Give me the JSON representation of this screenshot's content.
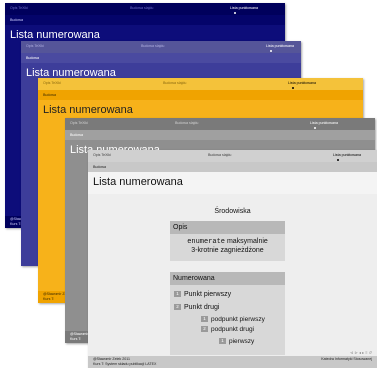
{
  "nav": {
    "left": "Opis TeXiki",
    "middle": "Budowa slajdu",
    "right": "Lista punktowana",
    "right_active": "Lista punktowana"
  },
  "subsection": "Budowa",
  "title": "Lista numerowana",
  "footer": {
    "author": "@Sławomir Zelek 2011",
    "short_author": "@Sławomir Zelek",
    "course": "Kurs T: System składu publikacji LATEX",
    "course_short": "Kurs T:",
    "dept": "Katedra Informatyki Stosowanej"
  },
  "content": {
    "env_label": "Środowiska",
    "opis_header": "Opis",
    "opis_line1_code": "enumerate",
    "opis_line1_rest": " maksymalnie",
    "opis_line2": "3-krotnie zagnieżdżone",
    "num_header": "Numerowana",
    "items": [
      {
        "n": "1",
        "text": "Punkt pierwszy"
      },
      {
        "n": "2",
        "text": "Punkt drugi"
      }
    ],
    "subitems": [
      {
        "n": "1",
        "text": "podpunkt pierwszy"
      },
      {
        "n": "2",
        "text": "podpunkt drugi"
      }
    ],
    "subsubitem": {
      "n": "1",
      "text": "pierwszy"
    }
  },
  "nav_symbols": "⊲ ⊳ ◂ ▸ ≡ ↺"
}
